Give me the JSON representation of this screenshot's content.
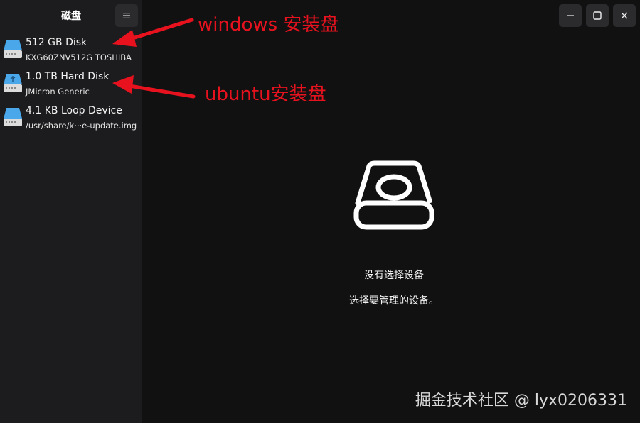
{
  "sidebar": {
    "title": "磁盘",
    "menu_icon": "hamburger-icon",
    "disks": [
      {
        "name": "512 GB Disk",
        "detail": "KXG60ZNV512G TOSHIBA",
        "icon": "ssd-drive-icon"
      },
      {
        "name": "1.0 TB Hard Disk",
        "detail": "JMicron Generic",
        "icon": "usb-drive-icon"
      },
      {
        "name": "4.1 KB Loop Device",
        "detail": "/usr/share/k···e-update.img",
        "icon": "loop-drive-icon"
      }
    ]
  },
  "window_controls": {
    "minimize": "minimize-icon",
    "maximize": "maximize-icon",
    "close": "close-icon"
  },
  "main": {
    "empty_icon": "drive-icon",
    "empty_title": "没有选择设备",
    "empty_subtitle": "选择要管理的设备。"
  },
  "annotations": {
    "windows_label": "windows 安装盘",
    "ubuntu_label": "ubuntu安装盘",
    "arrow_color": "#e8121f"
  },
  "watermark": "掘金技术社区 @ lyx0206331",
  "colors": {
    "sidebar_bg": "#1c1c1e",
    "main_bg": "#111112",
    "drive_blue": "#4aa8ea"
  }
}
